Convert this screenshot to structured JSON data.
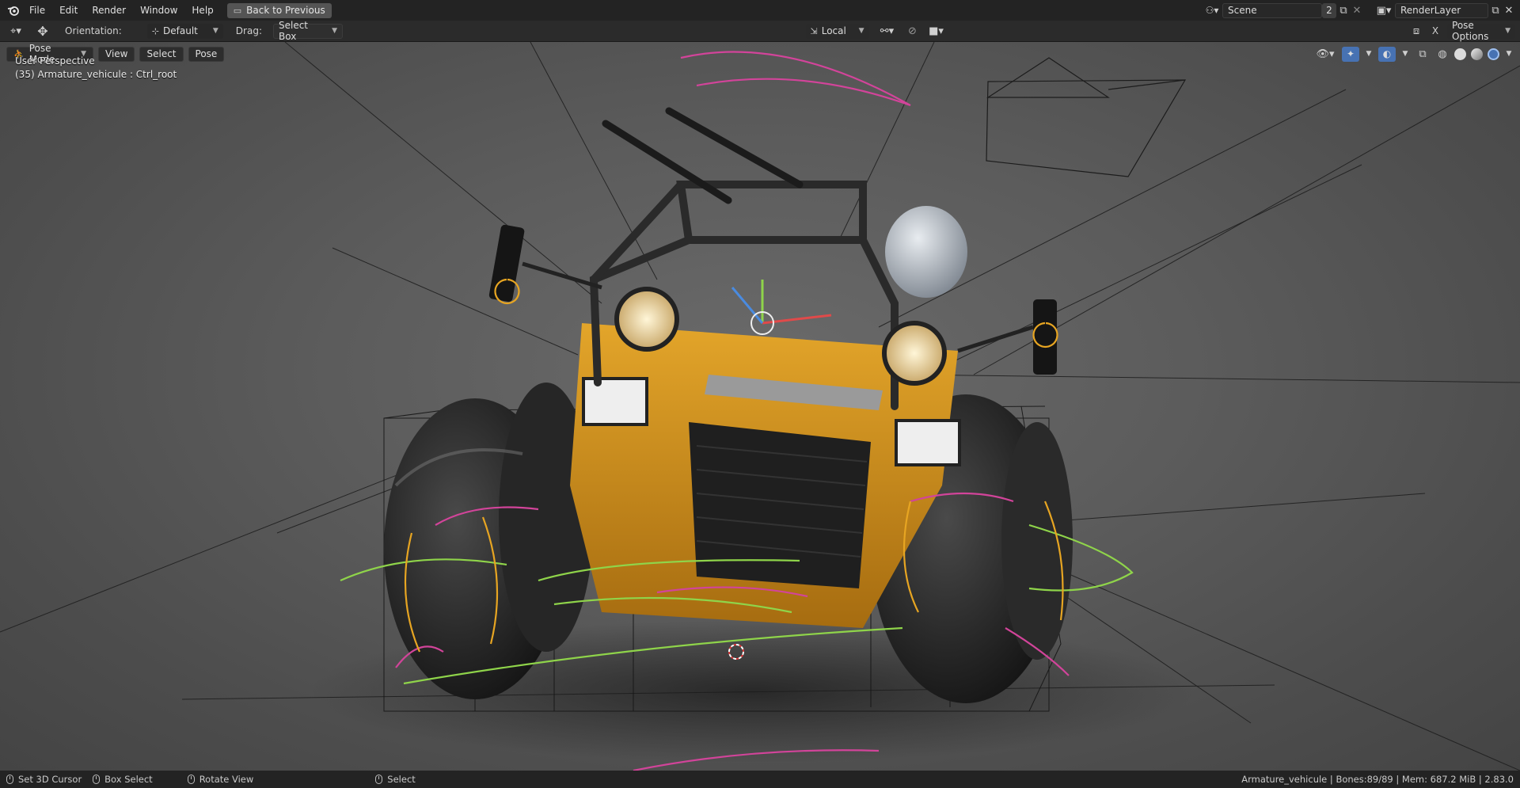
{
  "topbar": {
    "menus": [
      "File",
      "Edit",
      "Render",
      "Window",
      "Help"
    ],
    "back_button": "Back to Previous",
    "scene": {
      "name": "Scene",
      "users": "2"
    },
    "view_layer": "RenderLayer"
  },
  "toolbar": {
    "orientation_label": "Orientation:",
    "orientation_value": "Default",
    "drag_label": "Drag:",
    "drag_value": "Select Box",
    "transform_space": "Local",
    "options": "Pose Options"
  },
  "viewport": {
    "mode": "Pose Mode",
    "menus": [
      "View",
      "Select",
      "Pose"
    ],
    "perspective": "User Perspective",
    "active_info": "(35) Armature_vehicule : Ctrl_root"
  },
  "statusbar": {
    "left": [
      "Set 3D Cursor",
      "Box Select",
      "Rotate View",
      "Select"
    ],
    "right": "Armature_vehicule | Bones:89/89 | Mem: 687.2 MiB | 2.83.0"
  },
  "colors": {
    "accent": "#4772b3",
    "vehicle_yellow": "#d99a1c",
    "bone_pink": "#d2449a",
    "bone_green": "#8fd44a"
  }
}
